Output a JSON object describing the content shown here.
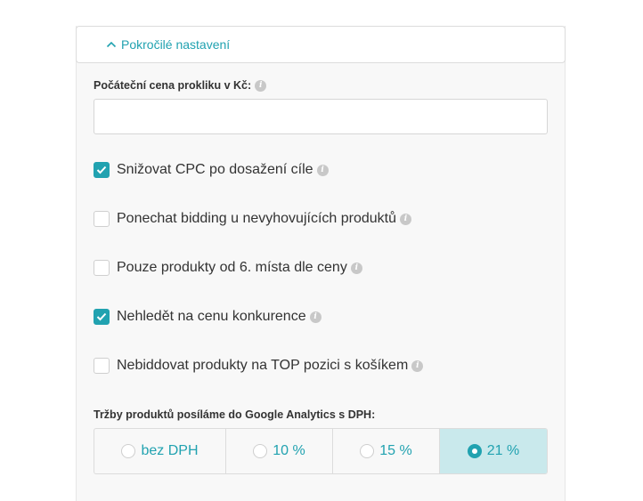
{
  "advanced": {
    "toggle_label": "Pokročilé nastavení"
  },
  "start_price": {
    "label": "Počáteční cena prokliku v Kč:",
    "value": "",
    "placeholder": ""
  },
  "options": [
    {
      "label": "Snižovat CPC po dosažení cíle",
      "checked": true
    },
    {
      "label": "Ponechat bidding u nevyhovujících produktů",
      "checked": false
    },
    {
      "label": "Pouze produkty od 6. místa dle ceny",
      "checked": false
    },
    {
      "label": "Nehledět na cenu konkurence",
      "checked": true
    },
    {
      "label": "Nebiddovat produkty na TOP pozici s košíkem",
      "checked": false
    }
  ],
  "vat": {
    "label": "Tržby produktů posíláme do Google Analytics s DPH:",
    "options": [
      {
        "label": "bez DPH",
        "selected": false
      },
      {
        "label": "10 %",
        "selected": false
      },
      {
        "label": "15 %",
        "selected": false
      },
      {
        "label": "21 %",
        "selected": true
      }
    ]
  },
  "colors": {
    "accent": "#21a2b0",
    "selected_bg": "#c9e9ec",
    "panel_bg": "#f8f8f8"
  },
  "icons": {
    "toggle": "chevron-up-icon",
    "info": "info-icon",
    "check": "checkmark-icon"
  }
}
